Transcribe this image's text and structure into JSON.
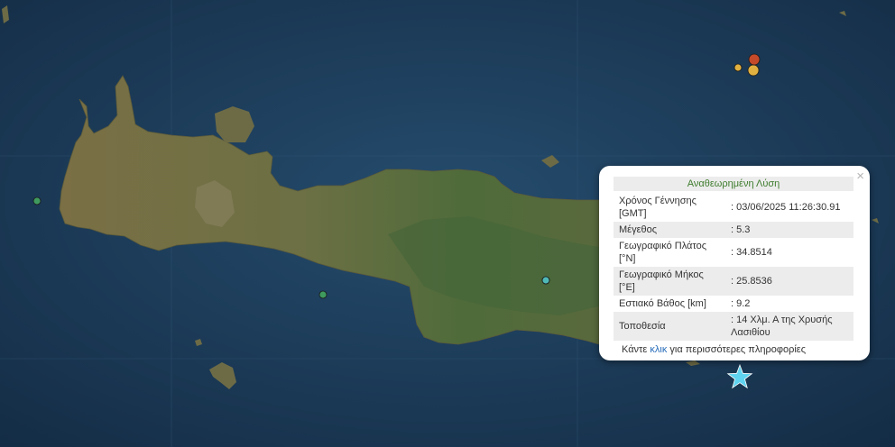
{
  "popup": {
    "title": "Αναθεωρημένη Λύση",
    "close_icon": "×",
    "rows": [
      {
        "label": "Χρόνος Γέννησης [GMT]",
        "value": ": 03/06/2025 11:26:30.91"
      },
      {
        "label": "Μέγεθος",
        "value": ": 5.3"
      },
      {
        "label": "Γεωγραφικό Πλάτος [°N]",
        "value": ": 34.8514"
      },
      {
        "label": "Γεωγραφικό Μήκος [°E]",
        "value": ": 25.8536"
      },
      {
        "label": "Εστιακό Βάθος [km]",
        "value": ": 9.2"
      },
      {
        "label": "Τοποθεσία",
        "value": ": 14 Χλμ. Α της Χρυσής Λασιθίου"
      }
    ],
    "more_prefix": "Κάντε",
    "more_link": "κλικ",
    "more_suffix": "για περισσότερες πληροφορίες"
  },
  "markers": {
    "epicenter_icon": "star-icon",
    "epicenter_color": "#5fd3f0",
    "event_colors": [
      "#3f9a5e",
      "#3f9a5e",
      "#3f9a5e",
      "#4fb9b8",
      "#e0b040",
      "#e07b2a",
      "#c44a2a"
    ]
  },
  "colors": {
    "sea": "#1b3a5a",
    "land": "#6f7246",
    "title_text": "#3f7d2e",
    "link": "#2a6ebb"
  }
}
